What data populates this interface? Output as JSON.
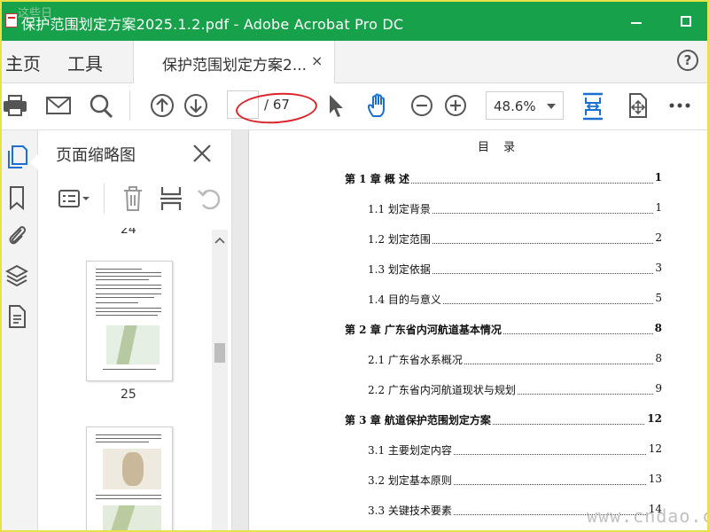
{
  "window": {
    "title": "保护范围划定方案2025.1.2.pdf - Adobe Acrobat Pro DC",
    "watermark_top": "这些日"
  },
  "tabs": {
    "home": "主页",
    "tools": "工具",
    "document": "保护范围划定方案2...",
    "close": "×",
    "help": "?"
  },
  "toolbar": {
    "page_current": "",
    "page_total": "/ 67",
    "zoom": "48.6%"
  },
  "panel": {
    "title": "页面缩略图",
    "thumb_top_label": "24",
    "thumb_label_a": "25"
  },
  "toc": {
    "title": "目 录",
    "entries": [
      {
        "text": "第 1 章 概  述",
        "page": "1",
        "level": 1
      },
      {
        "text": "1.1 划定背景",
        "page": "1",
        "level": 2
      },
      {
        "text": "1.2 划定范围",
        "page": "2",
        "level": 2
      },
      {
        "text": "1.3 划定依据",
        "page": "3",
        "level": 2
      },
      {
        "text": "1.4 目的与意义",
        "page": "5",
        "level": 2
      },
      {
        "text": "第 2 章 广东省内河航道基本情况",
        "page": "8",
        "level": 1
      },
      {
        "text": "2.1 广东省水系概况",
        "page": "8",
        "level": 2
      },
      {
        "text": "2.2 广东省内河航道现状与规划",
        "page": "9",
        "level": 2
      },
      {
        "text": "第 3 章 航道保护范围划定方案",
        "page": "12",
        "level": 1
      },
      {
        "text": "3.1 主要划定内容",
        "page": "12",
        "level": 2
      },
      {
        "text": "3.2 划定基本原则",
        "page": "13",
        "level": 2
      },
      {
        "text": "3.3 关键技术要素",
        "page": "14",
        "level": 2
      }
    ]
  },
  "watermark": "www.cndao.com",
  "colors": {
    "titlebar": "#16a14a",
    "accent_blue": "#1a6fd0",
    "annotation_red": "#d9262c",
    "frame": "#e8e24a"
  },
  "icons": {
    "toolbar": [
      "print-icon",
      "mail-icon",
      "search-icon",
      "page-up-icon",
      "page-down-icon",
      "select-cursor-icon",
      "hand-icon",
      "zoom-out-icon",
      "zoom-in-icon",
      "fit-page-icon",
      "rotate-view-icon",
      "more-icon"
    ],
    "rail": [
      "page-thumbnails-icon",
      "bookmark-icon",
      "attachment-icon",
      "layers-icon",
      "document-properties-icon"
    ],
    "panel_tools": [
      "thumbnail-options-icon",
      "delete-icon",
      "insert-page-icon",
      "rotate-icon"
    ]
  }
}
